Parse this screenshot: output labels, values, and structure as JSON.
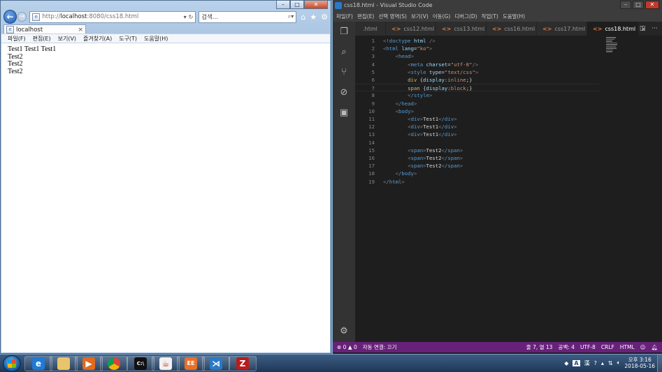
{
  "ie": {
    "address": {
      "prefix": "http://",
      "host": "localhost",
      "rest": ":8080/css18.html"
    },
    "search_placeholder": "검색...",
    "tab_title": "localhost",
    "tab_close": "×",
    "menu": [
      "파일(F)",
      "편집(E)",
      "보기(V)",
      "즐겨찾기(A)",
      "도구(T)",
      "도움말(H)"
    ],
    "content_lines": [
      "Test1 Test1 Test1",
      "Test2",
      "Test2",
      "Test2"
    ]
  },
  "vscode": {
    "title": "css18.html - Visual Studio Code",
    "menu": [
      "파일(F)",
      "편집(E)",
      "선택 영역(S)",
      "보기(V)",
      "이동(G)",
      "디버그(D)",
      "작업(T)",
      "도움말(H)"
    ],
    "tabs": [
      {
        "label": ".html",
        "active": false
      },
      {
        "label": "css12.html",
        "active": false
      },
      {
        "label": "css13.html",
        "active": false
      },
      {
        "label": "css16.html",
        "active": false
      },
      {
        "label": "css17.html",
        "active": false
      },
      {
        "label": "css18.html",
        "active": true
      }
    ],
    "tab_close": "×",
    "code_lines": [
      "<!doctype html />",
      "<html lang=\"ko\">",
      "    <head>",
      "        <meta charset=\"utf-8\"/>",
      "        <style type=\"text/css\">",
      "        div {display:inline;}",
      "        span {display:block;}",
      "        </style>",
      "    </head>",
      "    <body>",
      "        <div>Test1</div>",
      "        <div>Test1</div>",
      "        <div>Test1</div>",
      "",
      "        <span>Test2</span>",
      "        <span>Test2</span>",
      "        <span>Test2</span>",
      "    </body>",
      "</html>"
    ],
    "status": {
      "errors": "0",
      "warnings": "0",
      "live_share": "자동 연결: 끄기",
      "position": "줄 7, 열 13",
      "spaces": "공백: 4",
      "encoding": "UTF-8",
      "eol": "CRLF",
      "language": "HTML"
    },
    "colors": {
      "statusbar": "#68217a",
      "background": "#1e1e1e"
    }
  },
  "taskbar": {
    "apps": [
      "internet-explorer",
      "file-explorer",
      "media-player",
      "chrome",
      "command-prompt",
      "java",
      "eclipse",
      "visual-studio-code",
      "filezilla"
    ],
    "ime": "A",
    "ime_mode": "漢",
    "clock_ampm_time": "오후 3:16",
    "clock_date": "2018-05-16"
  }
}
